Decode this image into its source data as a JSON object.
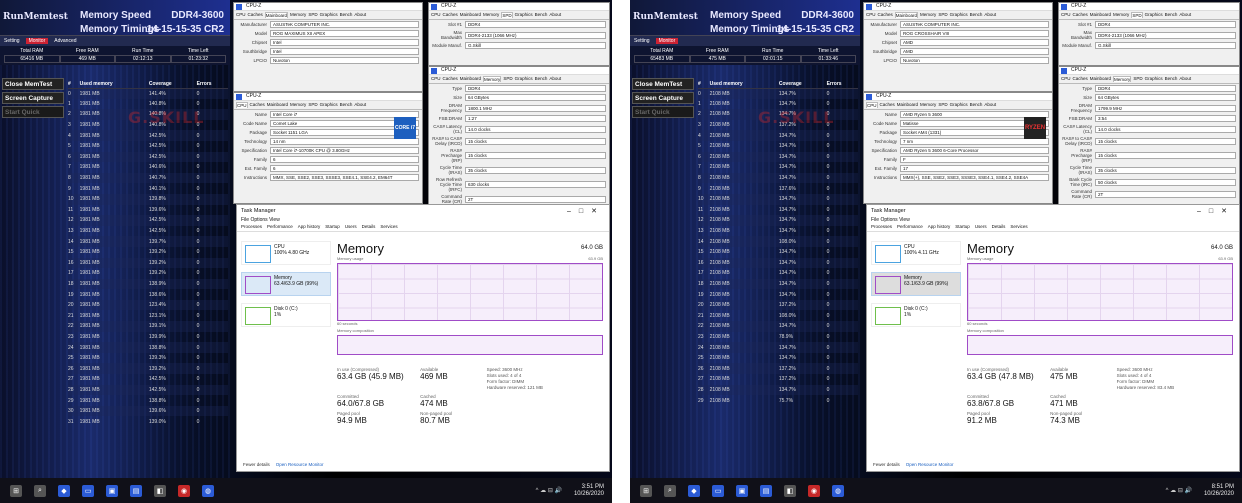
{
  "left": {
    "memtest": {
      "logo": "RunMemtest",
      "title1": "Memory Speed",
      "title2": "Memory Timings",
      "ddr": "DDR4-3600",
      "timings": "14-15-15-35 CR2",
      "menus": [
        "Setting",
        "Monitor",
        "Advanced"
      ],
      "stats_labels": [
        "Total RAM",
        "Free RAM",
        "Run Time",
        "Time Left"
      ],
      "stats_values": [
        "65416 MB",
        "469 MB",
        "02:12:13",
        "01:23:32"
      ],
      "buttons": [
        "Close MemTest",
        "Screen Capture",
        "Start Quick"
      ],
      "headers": [
        "#",
        "Used memory",
        "Coverage",
        "Errors"
      ],
      "rows": [
        [
          "0",
          "1981 MB",
          "141.4%",
          "0"
        ],
        [
          "1",
          "1981 MB",
          "140.8%",
          "0"
        ],
        [
          "2",
          "1981 MB",
          "140.8%",
          "0"
        ],
        [
          "3",
          "1981 MB",
          "140.8%",
          "0"
        ],
        [
          "4",
          "1981 MB",
          "142.5%",
          "0"
        ],
        [
          "5",
          "1981 MB",
          "142.5%",
          "0"
        ],
        [
          "6",
          "1981 MB",
          "142.5%",
          "0"
        ],
        [
          "7",
          "1981 MB",
          "140.6%",
          "0"
        ],
        [
          "8",
          "1981 MB",
          "140.7%",
          "0"
        ],
        [
          "9",
          "1981 MB",
          "140.1%",
          "0"
        ],
        [
          "10",
          "1981 MB",
          "139.8%",
          "0"
        ],
        [
          "11",
          "1981 MB",
          "139.6%",
          "0"
        ],
        [
          "12",
          "1981 MB",
          "142.5%",
          "0"
        ],
        [
          "13",
          "1981 MB",
          "142.5%",
          "0"
        ],
        [
          "14",
          "1981 MB",
          "139.7%",
          "0"
        ],
        [
          "15",
          "1981 MB",
          "139.2%",
          "0"
        ],
        [
          "16",
          "1981 MB",
          "139.2%",
          "0"
        ],
        [
          "17",
          "1981 MB",
          "139.2%",
          "0"
        ],
        [
          "18",
          "1981 MB",
          "138.9%",
          "0"
        ],
        [
          "19",
          "1981 MB",
          "138.6%",
          "0"
        ],
        [
          "20",
          "1981 MB",
          "123.4%",
          "0"
        ],
        [
          "21",
          "1981 MB",
          "123.1%",
          "0"
        ],
        [
          "22",
          "1981 MB",
          "139.1%",
          "0"
        ],
        [
          "23",
          "1981 MB",
          "139.9%",
          "0"
        ],
        [
          "24",
          "1981 MB",
          "138.8%",
          "0"
        ],
        [
          "25",
          "1981 MB",
          "139.3%",
          "0"
        ],
        [
          "26",
          "1981 MB",
          "139.2%",
          "0"
        ],
        [
          "27",
          "1981 MB",
          "142.5%",
          "0"
        ],
        [
          "28",
          "1981 MB",
          "142.5%",
          "0"
        ],
        [
          "29",
          "1981 MB",
          "138.8%",
          "0"
        ],
        [
          "30",
          "1981 MB",
          "139.6%",
          "0"
        ],
        [
          "31",
          "1981 MB",
          "139.0%",
          "0"
        ]
      ]
    },
    "cpuz_cpu": {
      "title": "CPU-Z",
      "tabs": [
        "CPU",
        "Caches",
        "Mainboard",
        "Memory",
        "SPD",
        "Graphics",
        "Bench",
        "About"
      ],
      "fields": [
        [
          "Name",
          "Intel Core i7"
        ],
        [
          "Code Name",
          "Comet Lake"
        ],
        [
          "Package",
          "Socket 1151 LGA"
        ],
        [
          "Technology",
          "14 nm"
        ],
        [
          "Specification",
          "Intel Core i7-10700K CPU @ 3.80GHz"
        ],
        [
          "Family",
          "6"
        ],
        [
          "Ext. Family",
          "6"
        ],
        [
          "Instructions",
          "MMX, SSE, SSE2, SSE3, SSSE3, SSE4.1, SSE4.2, EM64T"
        ]
      ],
      "logo": "CORE i7"
    },
    "cpuz_mb": {
      "title": "CPU-Z",
      "fields": [
        [
          "Manufacturer",
          "ASUSTeK COMPUTER INC."
        ],
        [
          "Model",
          "ROG MAXIMUS XII APEX"
        ],
        [
          "Chipset",
          "Intel"
        ],
        [
          "Southbridge",
          "Intel"
        ],
        [
          "LPCIO",
          "Nuvoton"
        ]
      ]
    },
    "cpuz_spd": {
      "title": "CPU-Z",
      "fields": [
        [
          "Slot #1",
          "DDR4"
        ],
        [
          "Max Bandwidth",
          "DDR4-2133 (1066 MHz)"
        ],
        [
          "Module Manuf.",
          "G.Skill"
        ]
      ]
    },
    "cpuz_mem": {
      "title": "CPU-Z",
      "fields": [
        [
          "Type",
          "DDR4"
        ],
        [
          "Size",
          "64 GBytes"
        ],
        [
          "DRAM Frequency",
          "1800.1 MHz"
        ],
        [
          "FSB:DRAM",
          "1:27"
        ],
        [
          "CAS# Latency (CL)",
          "14.0 clocks"
        ],
        [
          "RAS# to CAS# Delay (tRCD)",
          "15 clocks"
        ],
        [
          "RAS# Precharge (tRP)",
          "15 clocks"
        ],
        [
          "Cycle Time (tRAS)",
          "35 clocks"
        ],
        [
          "Row Refresh Cycle Time (tRFC)",
          "630 clocks"
        ],
        [
          "Command Rate (CR)",
          "2T"
        ]
      ]
    },
    "taskmgr": {
      "title": "Task Manager",
      "menu": "File  Options  View",
      "tabs": [
        "Processes",
        "Performance",
        "App history",
        "Startup",
        "Users",
        "Details",
        "Services"
      ],
      "cards": [
        [
          "CPU",
          "100% 4.80 GHz"
        ],
        [
          "Memory",
          "63.4/63.9 GB (99%)"
        ],
        [
          "Disk 0 (C:)",
          "1%"
        ]
      ],
      "heading": "Memory",
      "total": "64.0 GB",
      "usage_label": "Memory usage",
      "usage_max": "63.9 GB",
      "time": "60 seconds",
      "comp_label": "Memory composition",
      "in_use_label": "In use (Compressed)",
      "in_use": "63.4 GB (45.9 MB)",
      "avail_label": "Available",
      "avail": "469 MB",
      "committed_label": "Committed",
      "committed": "64.0/67.8 GB",
      "cached_label": "Cached",
      "cached": "474 MB",
      "paged_label": "Paged pool",
      "paged": "94.9 MB",
      "nonpaged_label": "Non-paged pool",
      "nonpaged": "80.7 MB",
      "speed": "Speed: 3600 MHz",
      "slots": "Slots used: 4 of 4",
      "form": "Form factor: DIMM",
      "reserved": "Hardware reserved: 121 MB",
      "fewer": "Fewer details",
      "resmon": "Open Resource Monitor"
    },
    "clock": [
      "3:51 PM",
      "10/26/2020"
    ]
  },
  "right": {
    "memtest": {
      "logo": "RunMemtest",
      "title1": "Memory Speed",
      "title2": "Memory Timings",
      "ddr": "DDR4-3600",
      "timings": "14-15-15-35 CR2",
      "menus": [
        "Setting",
        "Monitor"
      ],
      "stats_labels": [
        "Total RAM",
        "Free RAM",
        "Run Time",
        "Time Left"
      ],
      "stats_values": [
        "65483 MB",
        "475 MB",
        "02:01:15",
        "01:33:46"
      ],
      "buttons": [
        "Close MemTest",
        "Screen Capture",
        "Start Quick"
      ],
      "headers": [
        "#",
        "Used memory",
        "Coverage",
        "Errors"
      ],
      "rows": [
        [
          "0",
          "2108 MB",
          "134.7%",
          "0"
        ],
        [
          "1",
          "2108 MB",
          "134.7%",
          "0"
        ],
        [
          "2",
          "2108 MB",
          "134.7%",
          "0"
        ],
        [
          "3",
          "2108 MB",
          "137.2%",
          "0"
        ],
        [
          "4",
          "2108 MB",
          "134.7%",
          "0"
        ],
        [
          "5",
          "2108 MB",
          "134.7%",
          "0"
        ],
        [
          "6",
          "2108 MB",
          "134.7%",
          "0"
        ],
        [
          "7",
          "2108 MB",
          "134.7%",
          "0"
        ],
        [
          "8",
          "2108 MB",
          "134.7%",
          "0"
        ],
        [
          "9",
          "2108 MB",
          "137.6%",
          "0"
        ],
        [
          "10",
          "2108 MB",
          "134.7%",
          "0"
        ],
        [
          "11",
          "2108 MB",
          "134.7%",
          "0"
        ],
        [
          "12",
          "2108 MB",
          "134.7%",
          "0"
        ],
        [
          "13",
          "2108 MB",
          "134.7%",
          "0"
        ],
        [
          "14",
          "2108 MB",
          "108.0%",
          "0"
        ],
        [
          "15",
          "2108 MB",
          "134.7%",
          "0"
        ],
        [
          "16",
          "2108 MB",
          "134.7%",
          "0"
        ],
        [
          "17",
          "2108 MB",
          "134.7%",
          "0"
        ],
        [
          "18",
          "2108 MB",
          "134.7%",
          "0"
        ],
        [
          "19",
          "2108 MB",
          "134.7%",
          "0"
        ],
        [
          "20",
          "2108 MB",
          "137.2%",
          "0"
        ],
        [
          "21",
          "2108 MB",
          "108.0%",
          "0"
        ],
        [
          "22",
          "2108 MB",
          "134.7%",
          "0"
        ],
        [
          "23",
          "2108 MB",
          "78.9%",
          "0"
        ],
        [
          "24",
          "2108 MB",
          "134.7%",
          "0"
        ],
        [
          "25",
          "2108 MB",
          "134.7%",
          "0"
        ],
        [
          "26",
          "2108 MB",
          "137.2%",
          "0"
        ],
        [
          "27",
          "2108 MB",
          "137.2%",
          "0"
        ],
        [
          "28",
          "2108 MB",
          "134.7%",
          "0"
        ],
        [
          "29",
          "2108 MB",
          "75.7%",
          "0"
        ]
      ]
    },
    "cpuz_cpu": {
      "title": "CPU-Z",
      "tabs": [
        "CPU",
        "Caches",
        "Mainboard",
        "Memory",
        "SPD",
        "Graphics",
        "Bench",
        "About"
      ],
      "fields": [
        [
          "Name",
          "AMD Ryzen 5 3600"
        ],
        [
          "Code Name",
          "Matisse"
        ],
        [
          "Package",
          "Socket AM4 (1331)"
        ],
        [
          "Technology",
          "7 nm"
        ],
        [
          "Specification",
          "AMD Ryzen 5 3600 6-Core Processor"
        ],
        [
          "Family",
          "F"
        ],
        [
          "Ext. Family",
          "17"
        ],
        [
          "Instructions",
          "MMX(+), SSE, SSE2, SSE3, SSSE3, SSE4.1, SSE4.2, SSE4A"
        ]
      ],
      "logo": "RYZEN"
    },
    "cpuz_mb": {
      "title": "CPU-Z",
      "fields": [
        [
          "Manufacturer",
          "ASUSTeK COMPUTER INC."
        ],
        [
          "Model",
          "ROG CROSSHAIR VIII"
        ],
        [
          "Chipset",
          "AMD"
        ],
        [
          "Southbridge",
          "AMD"
        ],
        [
          "LPCIO",
          "Nuvoton"
        ]
      ]
    },
    "cpuz_spd": {
      "title": "CPU-Z",
      "fields": [
        [
          "Slot #1",
          "DDR4"
        ],
        [
          "Max Bandwidth",
          "DDR4-2133 (1066 MHz)"
        ],
        [
          "Module Manuf.",
          "G.Skill"
        ]
      ]
    },
    "cpuz_mem": {
      "title": "CPU-Z",
      "fields": [
        [
          "Type",
          "DDR4"
        ],
        [
          "Size",
          "64 GBytes"
        ],
        [
          "DRAM Frequency",
          "1799.9 MHz"
        ],
        [
          "FSB:DRAM",
          "3:54"
        ],
        [
          "CAS# Latency (CL)",
          "14.0 clocks"
        ],
        [
          "RAS# to CAS# Delay (tRCD)",
          "15 clocks"
        ],
        [
          "RAS# Precharge (tRP)",
          "15 clocks"
        ],
        [
          "Cycle Time (tRAS)",
          "35 clocks"
        ],
        [
          "Bank Cycle Time (tRC)",
          "50 clocks"
        ],
        [
          "Command Rate (CR)",
          "2T"
        ]
      ]
    },
    "taskmgr": {
      "title": "Task Manager",
      "menu": "File  Options  View",
      "tabs": [
        "Processes",
        "Performance",
        "App history",
        "Startup",
        "Users",
        "Details",
        "Services"
      ],
      "cards": [
        [
          "CPU",
          "100% 4.11 GHz"
        ],
        [
          "Memory",
          "63.1/63.9 GB (99%)"
        ],
        [
          "Disk 0 (C:)",
          "1%"
        ]
      ],
      "heading": "Memory",
      "total": "64.0 GB",
      "usage_label": "Memory usage",
      "usage_max": "63.9 GB",
      "time": "60 seconds",
      "comp_label": "Memory composition",
      "in_use_label": "In use (Compressed)",
      "in_use": "63.4 GB (47.8 MB)",
      "avail_label": "Available",
      "avail": "475 MB",
      "committed_label": "Committed",
      "committed": "63.8/67.8 GB",
      "cached_label": "Cached",
      "cached": "471 MB",
      "paged_label": "Paged pool",
      "paged": "91.2 MB",
      "nonpaged_label": "Non-paged pool",
      "nonpaged": "74.3 MB",
      "speed": "Speed: 3600 MHz",
      "slots": "Slots used: 4 of 4",
      "form": "Form factor: DIMM",
      "reserved": "Hardware reserved: 83.4 MB",
      "fewer": "Fewer details",
      "resmon": "Open Resource Monitor"
    },
    "clock": [
      "8:51 PM",
      "10/26/2020"
    ]
  },
  "watermark": "G.SKILL",
  "colors": {
    "memtest_accent": "#c22233",
    "tm_memory": "#a04cc7",
    "cpuz_blue": "#2b5bd6"
  }
}
